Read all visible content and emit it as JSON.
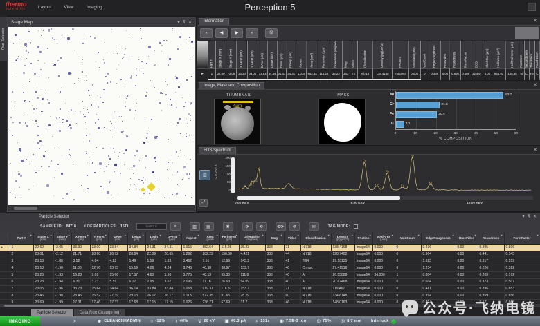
{
  "app": {
    "title": "Perception 5",
    "brand_top": "thermo",
    "brand_bottom": "scientific",
    "menu": [
      "Layout",
      "View",
      "Imaging"
    ],
    "run_selector_tab": "Run Selector"
  },
  "stage_map": {
    "title": "Stage Map",
    "dot_count": 470,
    "seed": 7,
    "dot_color": "#3d3d8f",
    "marker_color": "#e6d22e",
    "marker_x_pct": 75,
    "marker_y_pct": 88
  },
  "information": {
    "tab": "Information",
    "nav": {
      "first": "«",
      "prev": "◀",
      "next": "▶",
      "last": "»",
      "print": "⎙"
    },
    "columns": [
      "Part #",
      "Stage X (mm)",
      "Stage Y (mm)",
      "X Feret (µm)",
      "Y Feret (µm)",
      "DAve (µm)",
      "DMax (µm)",
      "DMin (µm)",
      "DPerp (µm)",
      "Aspect",
      "Area (µm²)",
      "Perimeter (µm)",
      "Orientation (degrees)",
      "Mag",
      "Video",
      "Classification",
      "Density (pg/µm^3)",
      "PAction",
      "VoidArea (µm²)",
      "VoidCount",
      "EdgeRoughness",
      "RmsVideo",
      "Roundness",
      "FormFactor",
      "ECD",
      "Skeleton (µm)",
      "HullArea (µm²)",
      "HullPerimeter (µm)",
      "FirstElem",
      "SecondElem",
      "ThirdElem",
      "FourthElem"
    ],
    "values": [
      "1",
      "22.60",
      "-2.05",
      "33.30",
      "33.00",
      "33.84",
      "34.84",
      "34.31",
      "34.31",
      "1.015",
      "852.54",
      "115.26",
      "35.23",
      "333",
      "71",
      "Ni718",
      "138.4168",
      "Image64",
      "0.000",
      "0",
      "0.436",
      "0.00",
      "0.895",
      "0.806",
      "32.947",
      "0.00",
      "865.93",
      "105.65",
      "Ni",
      "Cr",
      "Fe",
      "C"
    ]
  },
  "imc": {
    "tab": "Image, Mask and Composition",
    "thumbnail_label": "THUMBNAIL",
    "scale_label": "4µm",
    "mask_label": "MASK"
  },
  "eds": {
    "tab": "EDS Spectrum",
    "ylabel": "COUNTS"
  },
  "chart_data": [
    {
      "type": "bar",
      "orientation": "horizontal",
      "categories": [
        "Ni",
        "Cr",
        "Fe",
        "C"
      ],
      "values": [
        53.7,
        21.8,
        20.4,
        4.1
      ],
      "value_labels": [
        "53.7",
        "21.8",
        "20.4",
        "4.1"
      ],
      "xlabel": "% COMPOSITION",
      "xlim": [
        0,
        60
      ],
      "xticks": [
        0,
        10,
        20,
        30,
        40,
        50,
        60
      ],
      "bar_color": "#57a0d5"
    },
    {
      "type": "line",
      "title": "EDS Spectrum",
      "ylabel": "COUNTS",
      "yticks": [
        0,
        50,
        100,
        150,
        200
      ],
      "ylim": [
        0,
        220
      ],
      "x_kev_range": [
        0,
        12.6
      ],
      "xtick_labels": [
        "0.00 KEV",
        "5.00 KEV",
        "10.00 KEV"
      ],
      "xtick_kev": [
        0,
        5,
        10
      ],
      "line_color": "#d6c47c",
      "peaks": [
        {
          "kev": 0.27,
          "counts": 14,
          "label": "C"
        },
        {
          "kev": 0.52,
          "counts": 26,
          "label": "O"
        },
        {
          "kev": 0.6,
          "counts": 34,
          "label": "Cr"
        },
        {
          "kev": 0.72,
          "counts": 46,
          "label": "Fe"
        },
        {
          "kev": 0.86,
          "counts": 126,
          "label": "Ni"
        },
        {
          "kev": 2.15,
          "counts": 32,
          "label": ""
        },
        {
          "kev": 5.41,
          "counts": 170,
          "label": "Cr"
        },
        {
          "kev": 5.95,
          "counts": 22,
          "label": "Cr"
        },
        {
          "kev": 6.4,
          "counts": 106,
          "label": "Fe"
        },
        {
          "kev": 7.06,
          "counts": 18,
          "label": "Fe"
        },
        {
          "kev": 7.48,
          "counts": 204,
          "label": "Ni"
        },
        {
          "kev": 8.26,
          "counts": 35,
          "label": "Ni"
        }
      ]
    }
  ],
  "particle_selector": {
    "title": "Particle Selector",
    "sample_id_label": "SAMPLE ID:",
    "sample_id": "NI718",
    "particles_label": "# OF PARTICLES:",
    "particle_count": "1571",
    "search_placeholder": "PART #",
    "tag_mode_label": "TAG MODE:",
    "selected_row": 0,
    "columns": [
      {
        "name": "Part #",
        "unit": ""
      },
      {
        "name": "Stage X",
        "unit": "(mm)"
      },
      {
        "name": "Stage Y",
        "unit": "(mm)"
      },
      {
        "name": "X Feret",
        "unit": "(µm)"
      },
      {
        "name": "Y Feret",
        "unit": "(µm)"
      },
      {
        "name": "DAve",
        "unit": "(µm)"
      },
      {
        "name": "DMax",
        "unit": "(µm)"
      },
      {
        "name": "DMin",
        "unit": "(µm)"
      },
      {
        "name": "DPerp",
        "unit": "(µm)"
      },
      {
        "name": "Aspect",
        "unit": ""
      },
      {
        "name": "Area",
        "unit": "(µm²)"
      },
      {
        "name": "Perimeter",
        "unit": "(µm)"
      },
      {
        "name": "Orientation",
        "unit": "(degrees)"
      },
      {
        "name": "Mag",
        "unit": ""
      },
      {
        "name": "Video",
        "unit": ""
      },
      {
        "name": "Classification",
        "unit": ""
      },
      {
        "name": "Density",
        "unit": "(pg/µm^3)"
      },
      {
        "name": "PAction",
        "unit": ""
      },
      {
        "name": "VoidArea",
        "unit": "(µm²)"
      },
      {
        "name": "VoidCount",
        "unit": ""
      },
      {
        "name": "EdgeRoughness",
        "unit": ""
      },
      {
        "name": "RmsVideo",
        "unit": ""
      },
      {
        "name": "Roundness",
        "unit": ""
      },
      {
        "name": "FormFactor",
        "unit": ""
      }
    ],
    "rows": [
      [
        "1",
        "22.60",
        "-2.05",
        "33.30",
        "33.00",
        "33.84",
        "34.84",
        "34.31",
        "34.31",
        "1.015",
        "852.54",
        "115.26",
        "35.23",
        "333",
        "71",
        "Ni718",
        "138.4168",
        "Image64",
        "0.000",
        "0",
        "0.436",
        "0.00",
        "0.895",
        "0.806"
      ],
      [
        "2",
        "23.01",
        "-2.12",
        "21.71",
        "28.60",
        "26.72",
        "28.84",
        "22.09",
        "20.65",
        "1.292",
        "282.29",
        "156.60",
        "4.421",
        "333",
        "44",
        "Ni718",
        "128.7402",
        "Image64",
        "0.000",
        "0",
        "0.964",
        "0.00",
        "0.441",
        "0.145"
      ],
      [
        "3",
        "23.13",
        "-1.88",
        "3.52",
        "4.04",
        "4.82",
        "5.49",
        "1.59",
        "1.63",
        "3.462",
        "7.51",
        "12.99",
        "145.9",
        "333",
        "41",
        "Ti64",
        "29.10135",
        "Image64",
        "0.000",
        "0",
        "1.625",
        "0.00",
        "0.317",
        "0.559"
      ],
      [
        "4",
        "23.13",
        "-1.90",
        "11.00",
        "12.76",
        "13.75",
        "15.19",
        "4.06",
        "4.24",
        "3.745",
        "40.98",
        "38.97",
        "139.7",
        "333",
        "40",
        "C misc",
        "27.41916",
        "Image64",
        "0.000",
        "0",
        "1.234",
        "0.00",
        "0.226",
        "0.322"
      ],
      [
        "5",
        "23.23",
        "-1.93",
        "16.28",
        "9.09",
        "15.66",
        "17.37",
        "4.60",
        "5.96",
        "3.775",
        "48.13",
        "55.30",
        "111.8",
        "333",
        "40",
        "Al",
        "26.55888",
        "Image64",
        "34.000",
        "1",
        "0.804",
        "0.00",
        "0.203",
        "0.172"
      ],
      [
        "6",
        "23.23",
        "-1.94",
        "6.31",
        "3.23",
        "5.59",
        "6.17",
        "2.95",
        "3.07",
        "2.096",
        "11.16",
        "16.63",
        "94.09",
        "333",
        "40",
        "Al",
        "20.67468",
        "Image64",
        "0.000",
        "0",
        "0.604",
        "0.00",
        "0.373",
        "0.507"
      ],
      [
        "7",
        "23.05",
        "-1.96",
        "33.73",
        "35.64",
        "34.64",
        "36.14",
        "33.84",
        "33.84",
        "1.068",
        "919.37",
        "116.37",
        "153.7",
        "333",
        "71",
        "Ni718",
        "119.467",
        "Image64",
        "0.000",
        "0",
        "0.481",
        "0.00",
        "0.896",
        "0.853"
      ],
      [
        "8",
        "23.46",
        "-1.98",
        "28.45",
        "25.52",
        "27.39",
        "29.13",
        "26.17",
        "26.17",
        "1.113",
        "572.35",
        "91.65",
        "78.29",
        "333",
        "60",
        "Ni718",
        "134.8148",
        "Image64",
        "0.000",
        "0",
        "0.394",
        "0.00",
        "0.859",
        "0.856"
      ],
      [
        "9",
        "23.69",
        "-1.99",
        "17.31",
        "17.46",
        "17.33",
        "17.68",
        "17.15",
        "17.15",
        "1.026",
        "236.71",
        "67.69",
        "31.7",
        "333",
        "46",
        "Ni718",
        "148.0163",
        "Image64",
        "0.000",
        "0",
        "0.424",
        "0.00",
        "0.571",
        "0.803"
      ]
    ]
  },
  "bottom_tabs": [
    "Particle Selector",
    "Data Run Change log"
  ],
  "status_bar": {
    "mode": "IMAGING",
    "user": "CLEANCHKADMIN",
    "items": [
      {
        "icon": "brightness-icon",
        "glyph": "○",
        "text": "-12%"
      },
      {
        "icon": "contrast-icon",
        "glyph": "◑",
        "text": "40%"
      },
      {
        "icon": "voltage-icon",
        "glyph": "↯",
        "text": "20 kV"
      },
      {
        "icon": "current-icon",
        "glyph": "▣",
        "text": "40.3 µA"
      },
      {
        "icon": "magnification-icon",
        "glyph": "⌕",
        "text": "131x"
      },
      {
        "icon": "vacuum-icon",
        "glyph": "◉",
        "text": "7.5E-3 torr"
      },
      {
        "icon": "gauge-icon",
        "glyph": "⊙",
        "text": "75%"
      },
      {
        "icon": "distance-icon",
        "glyph": "◎",
        "text": "8.7 mm"
      }
    ],
    "interlock_label": "Interlock"
  },
  "watermark": {
    "text": "公众号·飞纳电镜"
  }
}
